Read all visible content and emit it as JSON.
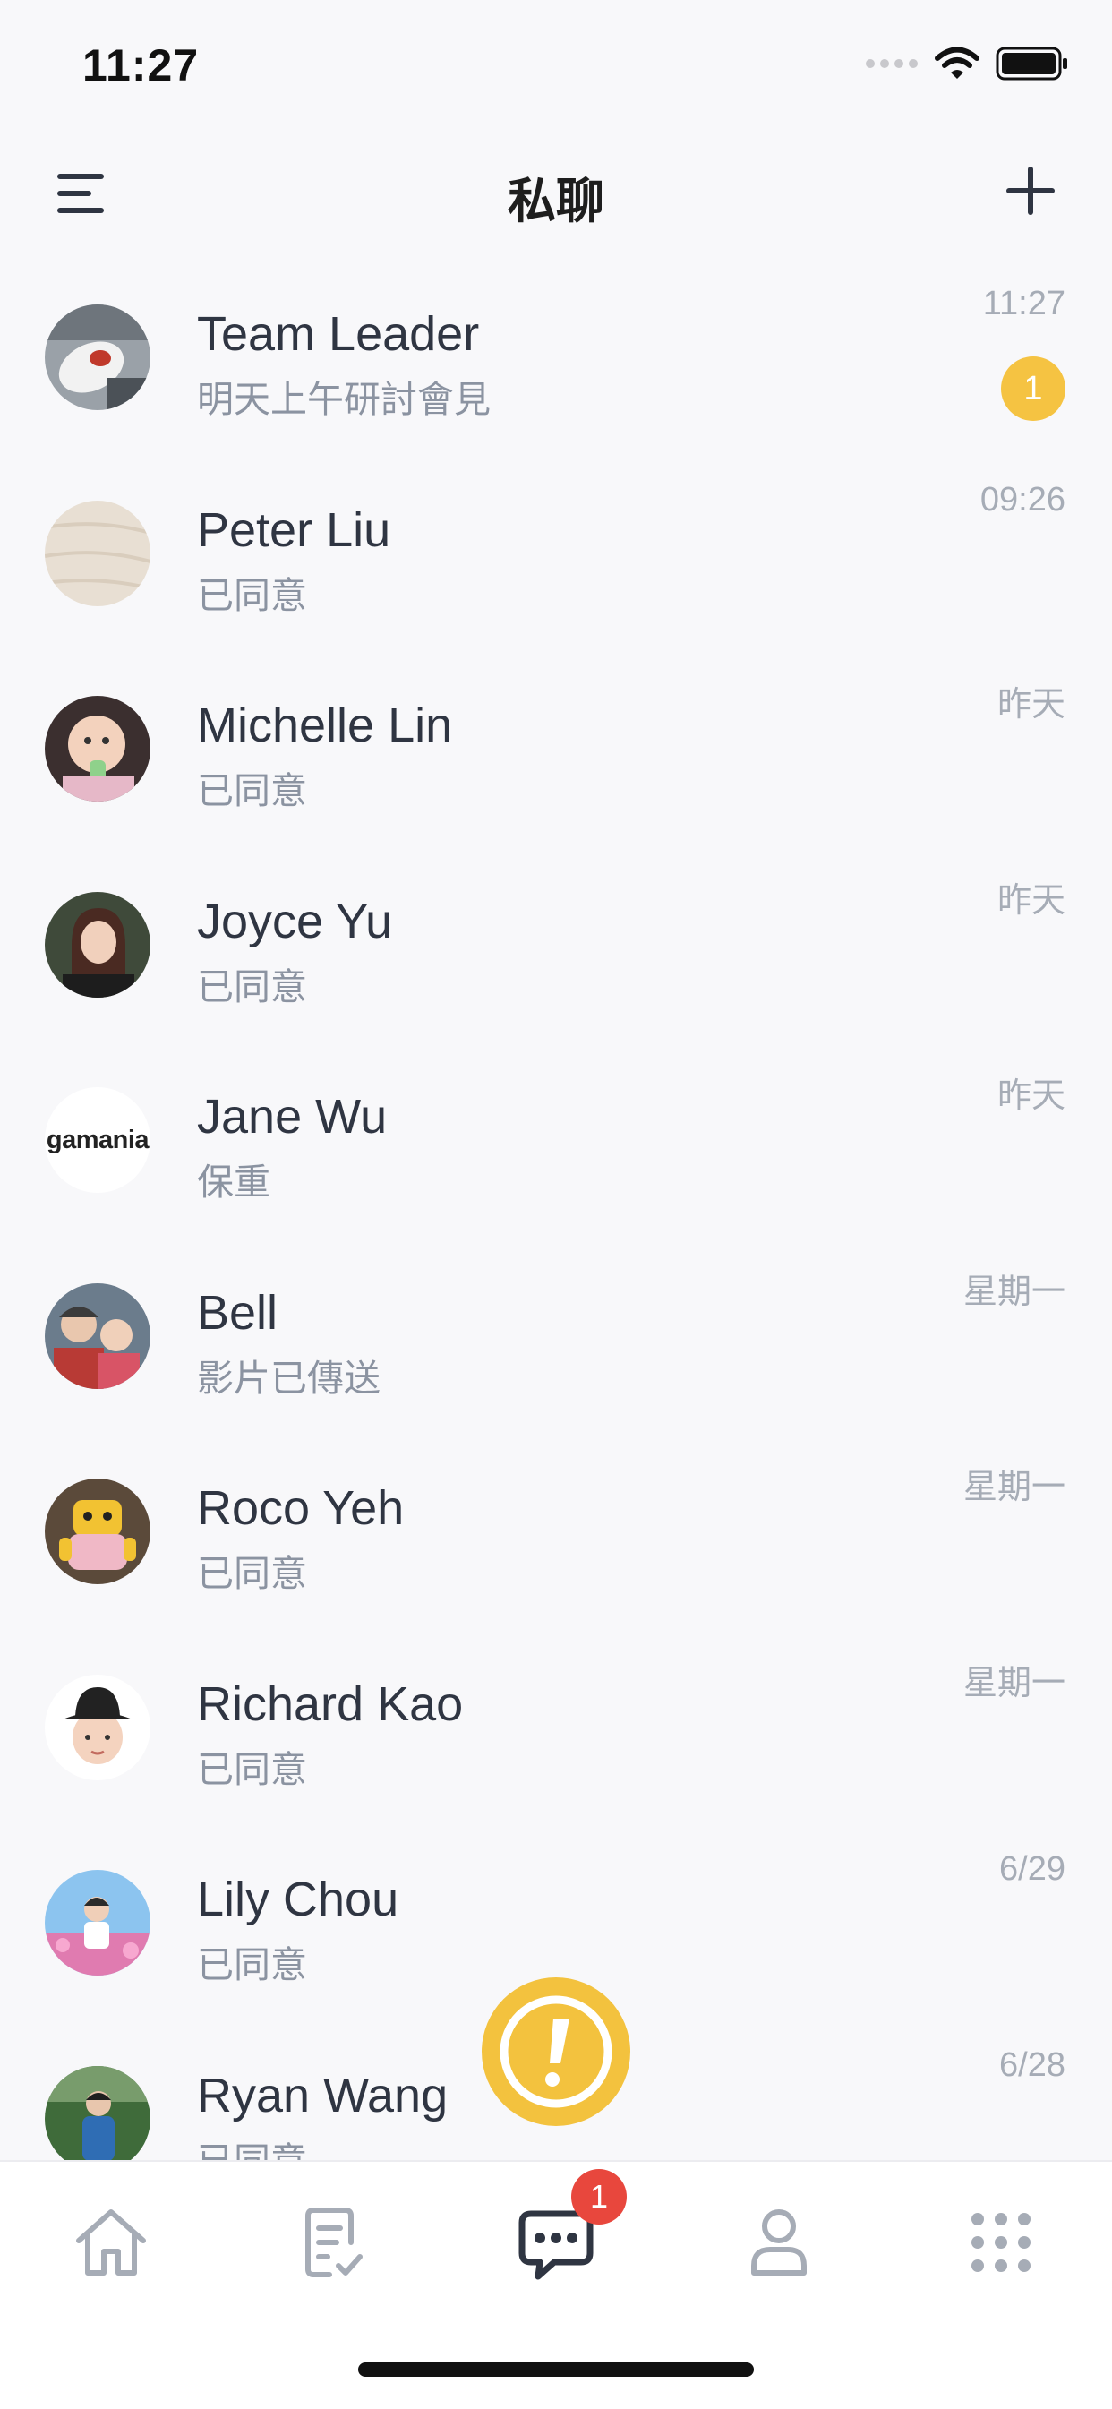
{
  "status_bar": {
    "time": "11:27"
  },
  "nav": {
    "title": "私聊"
  },
  "chats": [
    {
      "name": "Team Leader",
      "preview": "明天上午研討會見",
      "time": "11:27",
      "unread": "1",
      "avatar": "photo-mouse"
    },
    {
      "name": "Peter Liu",
      "preview": "已同意",
      "time": "09:26",
      "avatar": "photo-wood"
    },
    {
      "name": "Michelle Lin",
      "preview": "已同意",
      "time": "昨天",
      "avatar": "photo-baby"
    },
    {
      "name": "Joyce Yu",
      "preview": "已同意",
      "time": "昨天",
      "avatar": "photo-woman"
    },
    {
      "name": "Jane Wu",
      "preview": "保重",
      "time": "昨天",
      "avatar": "logo-gamania",
      "avatar_text": "gamania"
    },
    {
      "name": "Bell",
      "preview": "影片已傳送",
      "time": "星期一",
      "avatar": "photo-family"
    },
    {
      "name": "Roco Yeh",
      "preview": "已同意",
      "time": "星期一",
      "avatar": "photo-toy"
    },
    {
      "name": "Richard Kao",
      "preview": "已同意",
      "time": "星期一",
      "avatar": "memoji"
    },
    {
      "name": "Lily Chou",
      "preview": "已同意",
      "time": "6/29",
      "avatar": "photo-flowers"
    },
    {
      "name": "Ryan Wang",
      "preview": "已同意",
      "time": "6/28",
      "avatar": "photo-outdoor"
    }
  ],
  "tab_bar": {
    "tabs": [
      {
        "icon": "home-icon"
      },
      {
        "icon": "tasks-icon"
      },
      {
        "icon": "chat-icon",
        "active": true,
        "badge": "1"
      },
      {
        "icon": "profile-icon"
      },
      {
        "icon": "apps-grid-icon"
      }
    ]
  },
  "colors": {
    "accent": "#f5c342",
    "badge_red": "#e8473d",
    "text_primary": "#2f3542",
    "text_secondary": "#8b93a1",
    "inactive_icon": "#a6acb6"
  }
}
